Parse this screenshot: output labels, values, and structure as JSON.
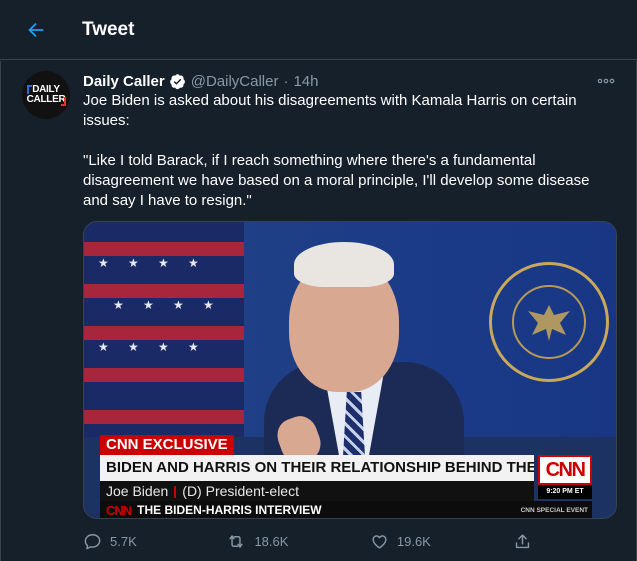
{
  "header": {
    "title": "Tweet",
    "back_icon": "arrow-left-icon"
  },
  "tweet": {
    "avatar": {
      "line1": "DAILY",
      "line2": "CALLER"
    },
    "display_name": "Daily Caller",
    "handle": "@DailyCaller",
    "separator": "·",
    "time": "14h",
    "text_line1": "Joe Biden is asked about his disagreements with Kamala Harris on certain issues:",
    "text_line2": "\"Like I told Barack, if I reach something where there's a fundamental disagreement we have based on a moral principle, I'll develop some disease and say I have to resign.\"",
    "media": {
      "chyron_label": "CNN EXCLUSIVE",
      "chyron_headline": "BIDEN AND HARRIS ON THEIR RELATIONSHIP BEHIND THE SCENES",
      "chyron_name": "Joe Biden",
      "chyron_title": "(D) President-elect",
      "logo_text": "CNN",
      "broadcast_time": "9:20 PM ET",
      "ticker_logo": "CNN",
      "ticker_text": "THE BIDEN-HARRIS INTERVIEW",
      "ticker_right": "CNN SPECIAL EVENT"
    },
    "actions": {
      "replies": "5.7K",
      "retweets": "18.6K",
      "likes": "19.6K"
    }
  },
  "colors": {
    "background": "#15202b",
    "accent": "#1da1f2",
    "muted": "#8899a6",
    "border": "#38444d"
  }
}
